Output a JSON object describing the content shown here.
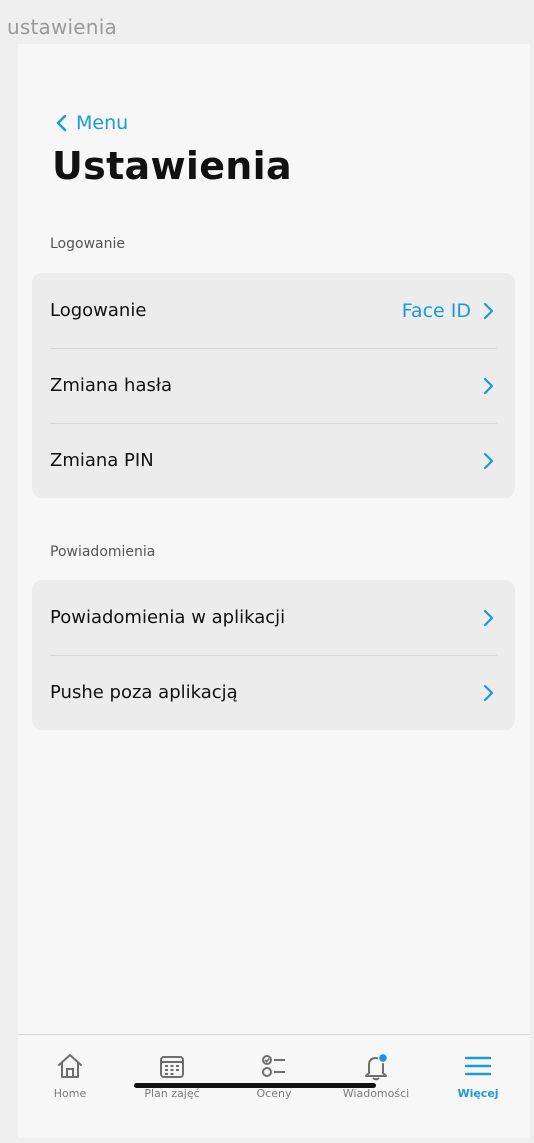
{
  "caption": "ustawienia",
  "header": {
    "back_label": "Menu",
    "title": "Ustawienia"
  },
  "sections": [
    {
      "label": "Logowanie",
      "rows": [
        {
          "label": "Logowanie",
          "value": "Face ID"
        },
        {
          "label": "Zmiana hasła",
          "value": ""
        },
        {
          "label": "Zmiana PIN",
          "value": ""
        }
      ]
    },
    {
      "label": "Powiadomienia",
      "rows": [
        {
          "label": "Powiadomienia w aplikacji",
          "value": ""
        },
        {
          "label": "Pushe poza aplikacją",
          "value": ""
        }
      ]
    }
  ],
  "tabbar": {
    "items": [
      {
        "label": "Home",
        "icon": "home-icon",
        "active": false
      },
      {
        "label": "Plan zajęć",
        "icon": "calendar-icon",
        "active": false
      },
      {
        "label": "Oceny",
        "icon": "checklist-icon",
        "active": false
      },
      {
        "label": "Wiadomości",
        "icon": "bell-icon",
        "active": false
      },
      {
        "label": "Więcej",
        "icon": "menu-icon",
        "active": true
      }
    ]
  },
  "colors": {
    "accent": "#1b9ad6",
    "background": "#f7f7f7",
    "group_background": "#ececec",
    "notification_dot": "#1b8fe0"
  }
}
